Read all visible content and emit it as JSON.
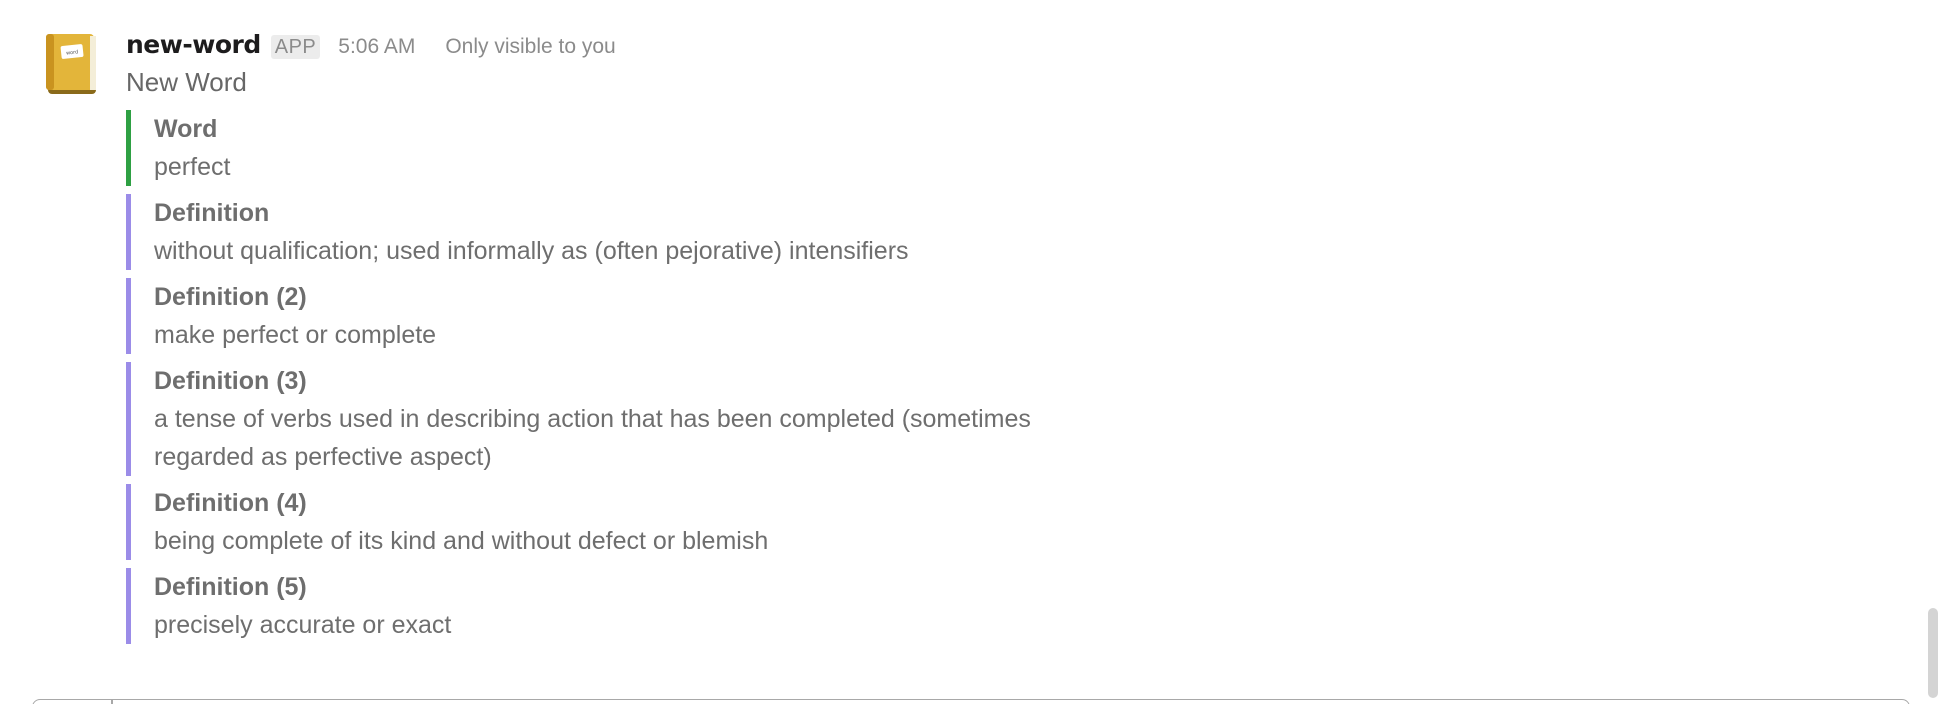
{
  "message": {
    "sender": "new-word",
    "badge": "APP",
    "timestamp": "5:06 AM",
    "visibility": "Only visible to you",
    "title": "New Word",
    "avatar_icon": "notebook-icon",
    "avatar_label": "word",
    "attachments": [
      {
        "title": "Word",
        "value": "perfect",
        "color": "#2ea043"
      },
      {
        "title": "Definition",
        "value": "without qualification; used informally as (often pejorative) intensifiers",
        "color": "#9b8ce8"
      },
      {
        "title": "Definition (2)",
        "value": "make perfect or complete",
        "color": "#9b8ce8"
      },
      {
        "title": "Definition (3)",
        "value": "a tense of verbs used in describing action that has been completed (sometimes regarded as perfective aspect)",
        "color": "#9b8ce8"
      },
      {
        "title": "Definition (4)",
        "value": "being complete of its kind and without defect or blemish",
        "color": "#9b8ce8"
      },
      {
        "title": "Definition (5)",
        "value": "precisely accurate or exact",
        "color": "#9b8ce8"
      }
    ]
  }
}
